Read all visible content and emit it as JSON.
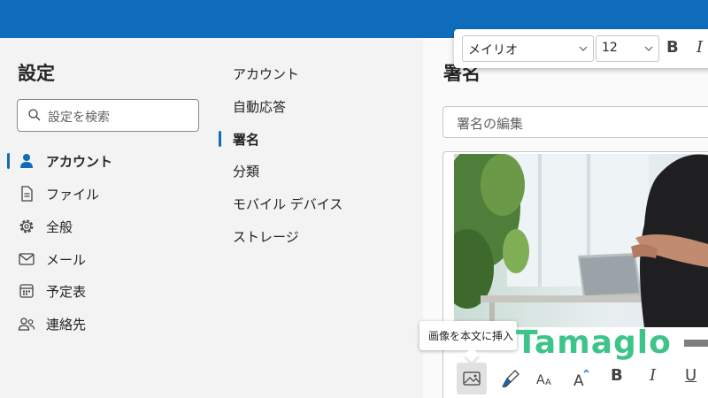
{
  "settings": {
    "title": "設定",
    "search_placeholder": "設定を検索"
  },
  "nav": [
    {
      "label": "アカウント",
      "icon": "person-icon",
      "active": true
    },
    {
      "label": "ファイル",
      "icon": "file-icon"
    },
    {
      "label": "全般",
      "icon": "gear-icon"
    },
    {
      "label": "メール",
      "icon": "mail-icon"
    },
    {
      "label": "予定表",
      "icon": "calendar-icon"
    },
    {
      "label": "連絡先",
      "icon": "people-icon"
    }
  ],
  "subnav": [
    {
      "label": "アカウント"
    },
    {
      "label": "自動応答"
    },
    {
      "label": "署名",
      "active": true
    },
    {
      "label": "分類"
    },
    {
      "label": "モバイル デバイス"
    },
    {
      "label": "ストレージ"
    }
  ],
  "signature": {
    "title": "署名",
    "edit_placeholder": "署名の編集"
  },
  "format_toolbar": {
    "font": "メイリオ",
    "size": "12",
    "bold": "B",
    "italic": "I"
  },
  "tooltip": {
    "text": "画像を本文に挿入"
  },
  "watermark": {
    "text": "Tamaglo"
  },
  "editor_toolbar": {
    "bold": "B",
    "italic": "I",
    "underline": "U"
  },
  "colors": {
    "accent": "#0f6cbd",
    "watermark": "#3ec488"
  }
}
